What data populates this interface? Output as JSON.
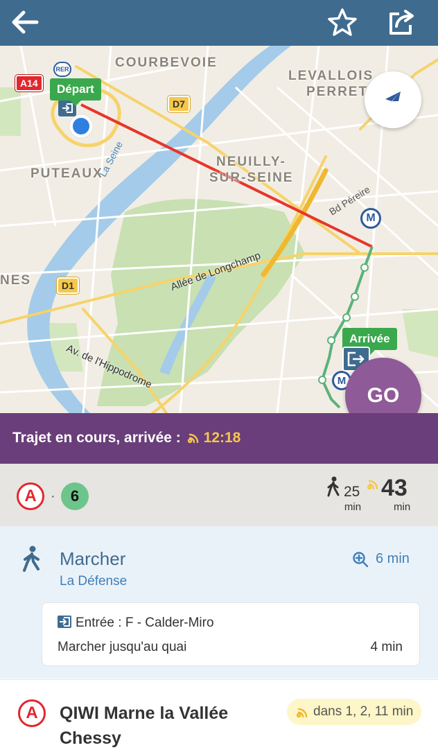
{
  "header": {
    "back_icon": "arrow-left-icon",
    "favorite_icon": "star-icon",
    "share_icon": "share-icon",
    "color": "#3f6b8f"
  },
  "map": {
    "place_labels": [
      "COURBEVOIE",
      "LEVALLOIS",
      "PERRET",
      "NEUILLY-",
      "SUR-SEINE",
      "PUTEAUX",
      "NES"
    ],
    "road_labels": [
      "La Seine",
      "Bd Péreire",
      "Allée de Longchamp",
      "Av. de l'Hippodrome"
    ],
    "road_badges": [
      "A14",
      "D7",
      "D1"
    ],
    "rer_badge": "RER",
    "metro_badge": "M",
    "departure_label": "Départ",
    "arrival_label": "Arrivée",
    "go_label": "GO"
  },
  "status": {
    "text": "Trajet en cours, arrivée :",
    "time": "12:18",
    "bg": "#6a3e7a",
    "accent": "#f6c74a"
  },
  "summary": {
    "lines": [
      "A",
      "6"
    ],
    "separator": "·",
    "walk_minutes": "25",
    "walk_unit": "min",
    "total_minutes": "43",
    "total_unit": "min"
  },
  "walk_step": {
    "title": "Marcher",
    "subtitle": "La Défense",
    "duration": "6 min",
    "entrance": "Entrée : F - Calder-Miro",
    "to_platform": "Marcher jusqu'au quai",
    "to_platform_duration": "4 min"
  },
  "transit_step": {
    "line": "A",
    "destination": "QIWI Marne la Vallée Chessy",
    "next_departures": "dans 1, 2, 11 min"
  }
}
